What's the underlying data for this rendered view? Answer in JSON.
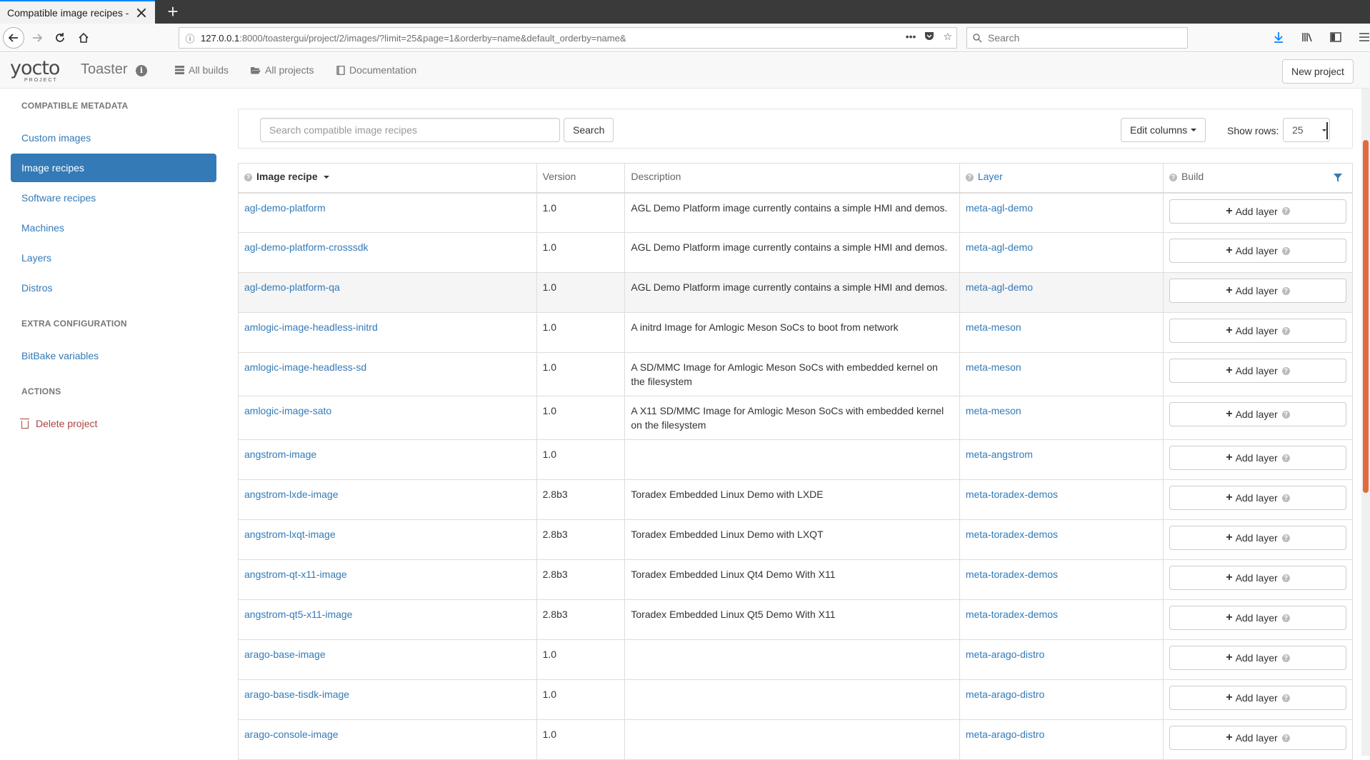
{
  "browser": {
    "tab_title": "Compatible image recipes -",
    "url_host": "127.0.0.1",
    "url_rest": ":8000/toastergui/project/2/images/?limit=25&page=1&orderby=name&default_orderby=name&",
    "search_placeholder": "Search"
  },
  "header": {
    "logo_word": "yocto",
    "logo_sub": "PROJECT",
    "brand": "Toaster",
    "nav": {
      "all_builds": "All builds",
      "all_projects": "All projects",
      "documentation": "Documentation"
    },
    "new_project": "New project"
  },
  "sidebar": {
    "compatible_heading": "COMPATIBLE METADATA",
    "items": [
      "Custom images",
      "Image recipes",
      "Software recipes",
      "Machines",
      "Layers",
      "Distros"
    ],
    "active": "Image recipes",
    "extra_heading": "EXTRA CONFIGURATION",
    "bitbake": "BitBake variables",
    "actions_heading": "ACTIONS",
    "delete": "Delete project"
  },
  "controls": {
    "search_placeholder": "Search compatible image recipes",
    "search_button": "Search",
    "edit_columns": "Edit columns",
    "show_rows_label": "Show rows:",
    "show_rows_value": "25"
  },
  "table": {
    "headers": {
      "recipe": "Image recipe",
      "version": "Version",
      "description": "Description",
      "layer": "Layer",
      "build": "Build"
    },
    "add_layer_label": "Add layer",
    "rows": [
      {
        "recipe": "agl-demo-platform",
        "version": "1.0",
        "description": "AGL Demo Platform image currently contains a simple HMI and demos.",
        "layer": "meta-agl-demo"
      },
      {
        "recipe": "agl-demo-platform-crosssdk",
        "version": "1.0",
        "description": "AGL Demo Platform image currently contains a simple HMI and demos.",
        "layer": "meta-agl-demo"
      },
      {
        "recipe": "agl-demo-platform-qa",
        "version": "1.0",
        "description": "AGL Demo Platform image currently contains a simple HMI and demos.",
        "layer": "meta-agl-demo"
      },
      {
        "recipe": "amlogic-image-headless-initrd",
        "version": "1.0",
        "description": "A initrd Image for Amlogic Meson SoCs to boot from network",
        "layer": "meta-meson"
      },
      {
        "recipe": "amlogic-image-headless-sd",
        "version": "1.0",
        "description": "A SD/MMC Image for Amlogic Meson SoCs with embedded kernel on the filesystem",
        "layer": "meta-meson"
      },
      {
        "recipe": "amlogic-image-sato",
        "version": "1.0",
        "description": "A X11 SD/MMC Image for Amlogic Meson SoCs with embedded kernel on the filesystem",
        "layer": "meta-meson"
      },
      {
        "recipe": "angstrom-image",
        "version": "1.0",
        "description": "",
        "layer": "meta-angstrom"
      },
      {
        "recipe": "angstrom-lxde-image",
        "version": "2.8b3",
        "description": "Toradex Embedded Linux Demo with LXDE",
        "layer": "meta-toradex-demos"
      },
      {
        "recipe": "angstrom-lxqt-image",
        "version": "2.8b3",
        "description": "Toradex Embedded Linux Demo with LXQT",
        "layer": "meta-toradex-demos"
      },
      {
        "recipe": "angstrom-qt-x11-image",
        "version": "2.8b3",
        "description": "Toradex Embedded Linux Qt4 Demo With X11",
        "layer": "meta-toradex-demos"
      },
      {
        "recipe": "angstrom-qt5-x11-image",
        "version": "2.8b3",
        "description": "Toradex Embedded Linux Qt5 Demo With X11",
        "layer": "meta-toradex-demos"
      },
      {
        "recipe": "arago-base-image",
        "version": "1.0",
        "description": "",
        "layer": "meta-arago-distro"
      },
      {
        "recipe": "arago-base-tisdk-image",
        "version": "1.0",
        "description": "",
        "layer": "meta-arago-distro"
      },
      {
        "recipe": "arago-console-image",
        "version": "1.0",
        "description": "",
        "layer": "meta-arago-distro"
      }
    ]
  },
  "colors": {
    "link": "#337ab7",
    "active_bg": "#337ab7",
    "danger": "#a94442",
    "scroll_thumb": "#e06b3e"
  }
}
